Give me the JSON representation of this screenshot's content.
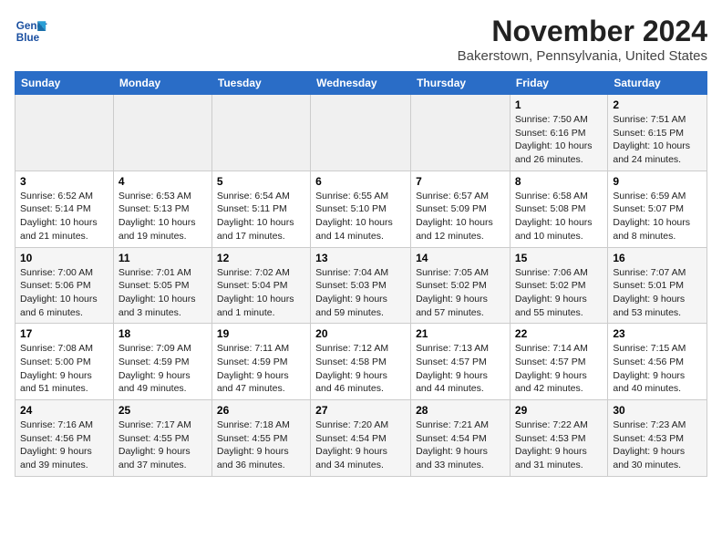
{
  "logo": {
    "line1": "General",
    "line2": "Blue"
  },
  "title": "November 2024",
  "location": "Bakerstown, Pennsylvania, United States",
  "weekdays": [
    "Sunday",
    "Monday",
    "Tuesday",
    "Wednesday",
    "Thursday",
    "Friday",
    "Saturday"
  ],
  "weeks": [
    [
      {
        "day": "",
        "info": ""
      },
      {
        "day": "",
        "info": ""
      },
      {
        "day": "",
        "info": ""
      },
      {
        "day": "",
        "info": ""
      },
      {
        "day": "",
        "info": ""
      },
      {
        "day": "1",
        "info": "Sunrise: 7:50 AM\nSunset: 6:16 PM\nDaylight: 10 hours\nand 26 minutes."
      },
      {
        "day": "2",
        "info": "Sunrise: 7:51 AM\nSunset: 6:15 PM\nDaylight: 10 hours\nand 24 minutes."
      }
    ],
    [
      {
        "day": "3",
        "info": "Sunrise: 6:52 AM\nSunset: 5:14 PM\nDaylight: 10 hours\nand 21 minutes."
      },
      {
        "day": "4",
        "info": "Sunrise: 6:53 AM\nSunset: 5:13 PM\nDaylight: 10 hours\nand 19 minutes."
      },
      {
        "day": "5",
        "info": "Sunrise: 6:54 AM\nSunset: 5:11 PM\nDaylight: 10 hours\nand 17 minutes."
      },
      {
        "day": "6",
        "info": "Sunrise: 6:55 AM\nSunset: 5:10 PM\nDaylight: 10 hours\nand 14 minutes."
      },
      {
        "day": "7",
        "info": "Sunrise: 6:57 AM\nSunset: 5:09 PM\nDaylight: 10 hours\nand 12 minutes."
      },
      {
        "day": "8",
        "info": "Sunrise: 6:58 AM\nSunset: 5:08 PM\nDaylight: 10 hours\nand 10 minutes."
      },
      {
        "day": "9",
        "info": "Sunrise: 6:59 AM\nSunset: 5:07 PM\nDaylight: 10 hours\nand 8 minutes."
      }
    ],
    [
      {
        "day": "10",
        "info": "Sunrise: 7:00 AM\nSunset: 5:06 PM\nDaylight: 10 hours\nand 6 minutes."
      },
      {
        "day": "11",
        "info": "Sunrise: 7:01 AM\nSunset: 5:05 PM\nDaylight: 10 hours\nand 3 minutes."
      },
      {
        "day": "12",
        "info": "Sunrise: 7:02 AM\nSunset: 5:04 PM\nDaylight: 10 hours\nand 1 minute."
      },
      {
        "day": "13",
        "info": "Sunrise: 7:04 AM\nSunset: 5:03 PM\nDaylight: 9 hours\nand 59 minutes."
      },
      {
        "day": "14",
        "info": "Sunrise: 7:05 AM\nSunset: 5:02 PM\nDaylight: 9 hours\nand 57 minutes."
      },
      {
        "day": "15",
        "info": "Sunrise: 7:06 AM\nSunset: 5:02 PM\nDaylight: 9 hours\nand 55 minutes."
      },
      {
        "day": "16",
        "info": "Sunrise: 7:07 AM\nSunset: 5:01 PM\nDaylight: 9 hours\nand 53 minutes."
      }
    ],
    [
      {
        "day": "17",
        "info": "Sunrise: 7:08 AM\nSunset: 5:00 PM\nDaylight: 9 hours\nand 51 minutes."
      },
      {
        "day": "18",
        "info": "Sunrise: 7:09 AM\nSunset: 4:59 PM\nDaylight: 9 hours\nand 49 minutes."
      },
      {
        "day": "19",
        "info": "Sunrise: 7:11 AM\nSunset: 4:59 PM\nDaylight: 9 hours\nand 47 minutes."
      },
      {
        "day": "20",
        "info": "Sunrise: 7:12 AM\nSunset: 4:58 PM\nDaylight: 9 hours\nand 46 minutes."
      },
      {
        "day": "21",
        "info": "Sunrise: 7:13 AM\nSunset: 4:57 PM\nDaylight: 9 hours\nand 44 minutes."
      },
      {
        "day": "22",
        "info": "Sunrise: 7:14 AM\nSunset: 4:57 PM\nDaylight: 9 hours\nand 42 minutes."
      },
      {
        "day": "23",
        "info": "Sunrise: 7:15 AM\nSunset: 4:56 PM\nDaylight: 9 hours\nand 40 minutes."
      }
    ],
    [
      {
        "day": "24",
        "info": "Sunrise: 7:16 AM\nSunset: 4:56 PM\nDaylight: 9 hours\nand 39 minutes."
      },
      {
        "day": "25",
        "info": "Sunrise: 7:17 AM\nSunset: 4:55 PM\nDaylight: 9 hours\nand 37 minutes."
      },
      {
        "day": "26",
        "info": "Sunrise: 7:18 AM\nSunset: 4:55 PM\nDaylight: 9 hours\nand 36 minutes."
      },
      {
        "day": "27",
        "info": "Sunrise: 7:20 AM\nSunset: 4:54 PM\nDaylight: 9 hours\nand 34 minutes."
      },
      {
        "day": "28",
        "info": "Sunrise: 7:21 AM\nSunset: 4:54 PM\nDaylight: 9 hours\nand 33 minutes."
      },
      {
        "day": "29",
        "info": "Sunrise: 7:22 AM\nSunset: 4:53 PM\nDaylight: 9 hours\nand 31 minutes."
      },
      {
        "day": "30",
        "info": "Sunrise: 7:23 AM\nSunset: 4:53 PM\nDaylight: 9 hours\nand 30 minutes."
      }
    ]
  ]
}
